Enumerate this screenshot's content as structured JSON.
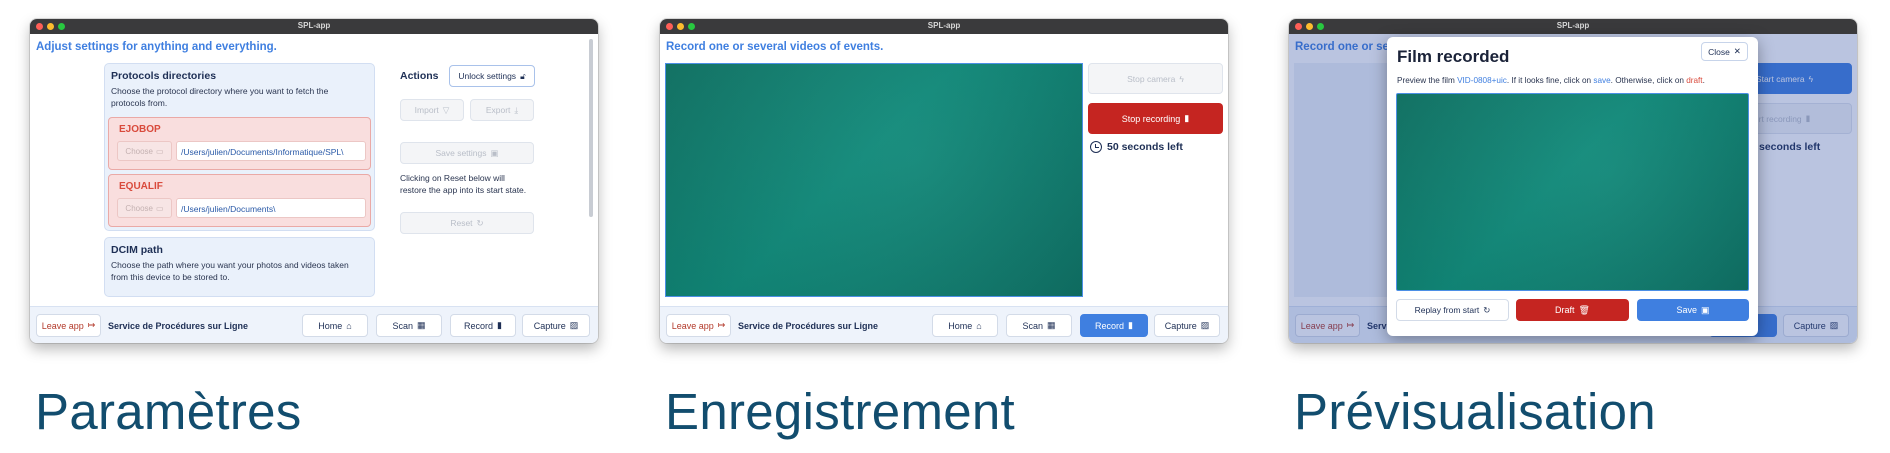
{
  "app_title": "SPL-app",
  "footer": {
    "leave": "Leave app",
    "service": "Service de Procédures sur Ligne",
    "home": "Home",
    "scan": "Scan",
    "record": "Record",
    "capture": "Capture"
  },
  "settings": {
    "heading": "Adjust settings for anything and everything.",
    "protocols_title": "Protocols directories",
    "protocols_desc": "Choose the protocol directory where you want to fetch the protocols from.",
    "entries": [
      {
        "name": "EJOBOP",
        "choose": "Choose",
        "path": "/Users/julien/Documents/Informatique/SPL\\"
      },
      {
        "name": "EQUALIF",
        "choose": "Choose",
        "path": "/Users/julien/Documents\\"
      }
    ],
    "dcim_title": "DCIM path",
    "dcim_desc": "Choose the path where you want your photos and videos taken from this device to be stored to.",
    "actions_title": "Actions",
    "unlock": "Unlock settings",
    "import": "Import",
    "export": "Export",
    "save_settings": "Save settings",
    "reset_text": "Clicking on Reset below will restore the app into its start state.",
    "reset": "Reset"
  },
  "recording": {
    "heading": "Record one or several videos of events.",
    "stop_camera": "Stop camera",
    "stop_recording": "Stop recording",
    "seconds_left": "50 seconds left"
  },
  "preview": {
    "heading_partial": "Record one or sev",
    "start_camera_partial": "Start camera",
    "recording_partial": "rt recording",
    "seconds_partial": "seconds left",
    "modal_title": "Film recorded",
    "close": "Close",
    "desc_prefix": "Preview the film ",
    "film_id": "VID-0808+uic",
    "desc_mid": ". If it looks fine, click on ",
    "desc_save": "save",
    "desc_mid2": ". Otherwise, click on ",
    "desc_draft": "draft",
    "desc_end": ".",
    "replay": "Replay from start",
    "draft": "Draft",
    "save": "Save"
  },
  "captions": {
    "settings": "Paramètres",
    "recording": "Enregistrement",
    "preview": "Prévisualisation"
  },
  "colors": {
    "accent": "#3f7fe0",
    "danger": "#c52521",
    "caption": "#124d6e",
    "video": "#0f8a7a"
  }
}
